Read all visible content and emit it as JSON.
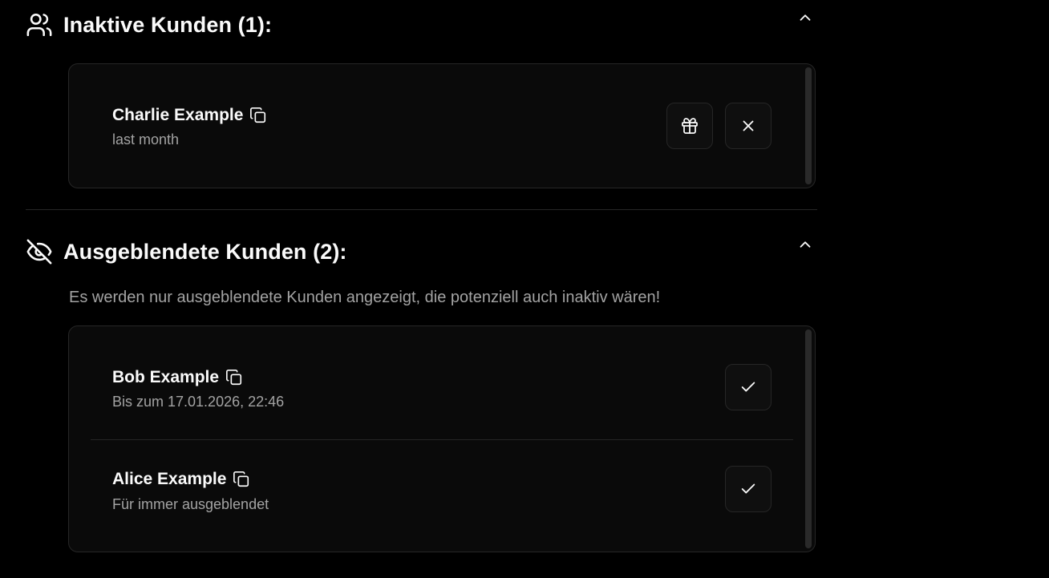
{
  "inactive": {
    "title": "Inaktive Kunden (1):",
    "icon": "users-icon",
    "customers": [
      {
        "name": "Charlie Example",
        "subtitle": "last month",
        "actions": [
          "gift-icon",
          "close-icon"
        ]
      }
    ]
  },
  "hidden": {
    "title": "Ausgeblendete Kunden (2):",
    "icon": "eye-off-icon",
    "info": "Es werden nur ausgeblendete Kunden angezeigt, die potenziell auch inaktiv wären!",
    "customers": [
      {
        "name": "Bob Example",
        "subtitle": "Bis zum 17.01.2026, 22:46",
        "actions": [
          "check-icon"
        ]
      },
      {
        "name": "Alice Example",
        "subtitle": "Für immer ausgeblendet",
        "actions": [
          "check-icon"
        ]
      }
    ]
  },
  "colors": {
    "background": "#000000",
    "card": "#0a0a0a",
    "border": "#262626",
    "text": "#fafafa",
    "muted": "#a3a3a3"
  }
}
